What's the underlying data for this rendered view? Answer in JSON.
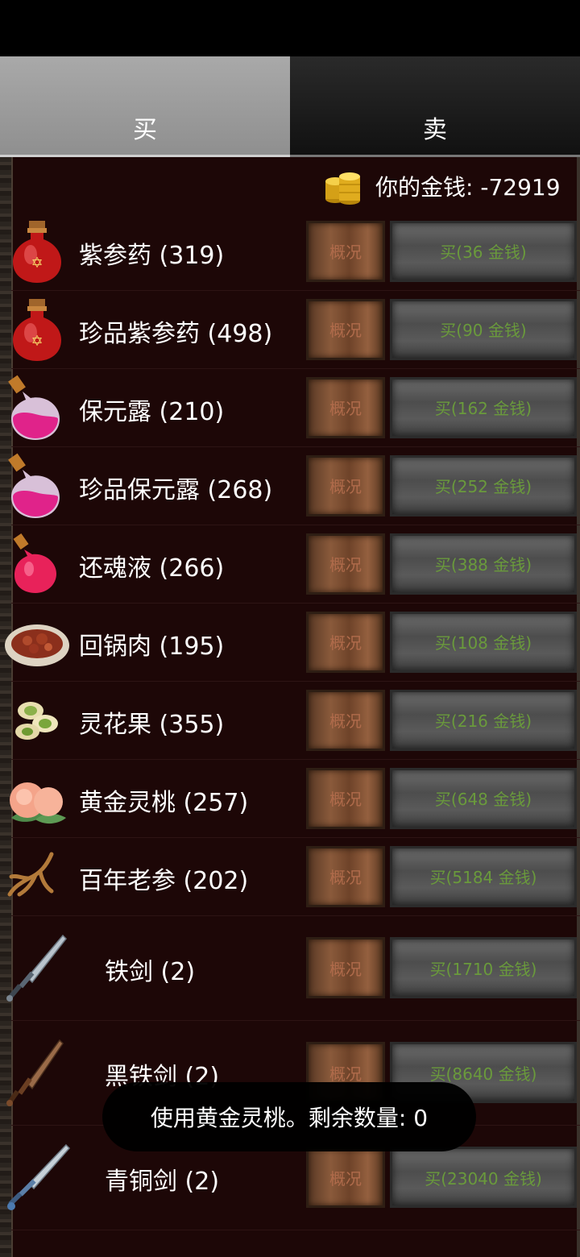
{
  "tabs": {
    "buy_label": "买",
    "sell_label": "卖"
  },
  "money": {
    "label": "你的金钱: -72919"
  },
  "info_label": "概况",
  "items": [
    {
      "name": "紫参药 (319)",
      "buy": "买(36 金钱)",
      "icon": "red-potion-icon"
    },
    {
      "name": "珍品紫参药 (498)",
      "buy": "买(90 金钱)",
      "icon": "red-potion-icon"
    },
    {
      "name": "保元露 (210)",
      "buy": "买(162 金钱)",
      "icon": "pink-flask-icon"
    },
    {
      "name": "珍品保元露 (268)",
      "buy": "买(252 金钱)",
      "icon": "pink-flask-icon"
    },
    {
      "name": "还魂液 (266)",
      "buy": "买(388 金钱)",
      "icon": "red-flask-icon"
    },
    {
      "name": "回锅肉 (195)",
      "buy": "买(108 金钱)",
      "icon": "meat-plate-icon"
    },
    {
      "name": "灵花果 (355)",
      "buy": "买(216 金钱)",
      "icon": "pistachio-icon"
    },
    {
      "name": "黄金灵桃 (257)",
      "buy": "买(648 金钱)",
      "icon": "peach-icon"
    },
    {
      "name": "百年老参 (202)",
      "buy": "买(5184 金钱)",
      "icon": "ginseng-icon"
    },
    {
      "name": "铁剑 (2)",
      "buy": "买(1710 金钱)",
      "icon": "iron-sword-icon"
    },
    {
      "name": "黑铁剑 (2)",
      "buy": "买(8640 金钱)",
      "icon": "black-iron-sword-icon"
    },
    {
      "name": "青铜剑 (2)",
      "buy": "买(23040 金钱)",
      "icon": "bronze-sword-icon"
    }
  ],
  "toast": "使用黄金灵桃。剩余数量: 0"
}
